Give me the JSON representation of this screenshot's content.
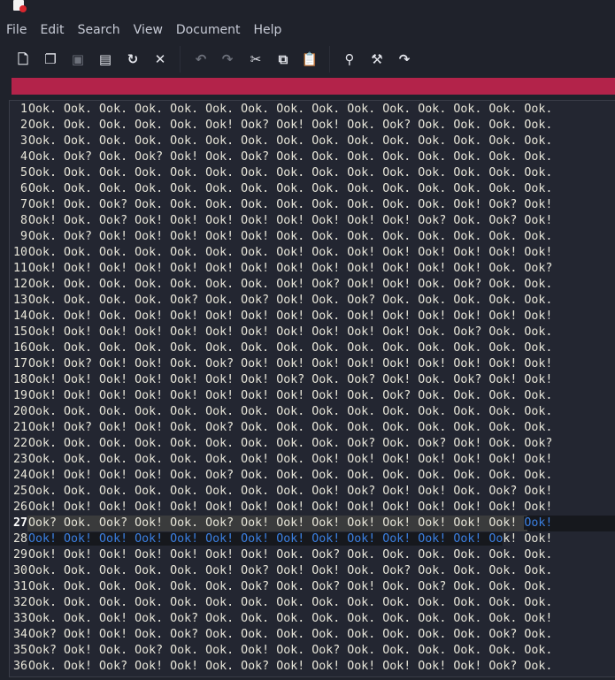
{
  "menu": [
    "File",
    "Edit",
    "Search",
    "View",
    "Document",
    "Help"
  ],
  "toolbar": [
    {
      "name": "new-document-icon",
      "glyph": "🗋"
    },
    {
      "name": "new-window-icon",
      "glyph": "❐"
    },
    {
      "name": "save-icon",
      "glyph": "▣"
    },
    {
      "name": "save-as-icon",
      "glyph": "▤"
    },
    {
      "name": "reload-icon",
      "glyph": "↻"
    },
    {
      "name": "close-icon",
      "glyph": "✕"
    },
    {
      "name": "undo-icon",
      "glyph": "↶"
    },
    {
      "name": "redo-icon",
      "glyph": "↷"
    },
    {
      "name": "cut-icon",
      "glyph": "✂"
    },
    {
      "name": "copy-icon",
      "glyph": "⧉"
    },
    {
      "name": "paste-icon",
      "glyph": "📋"
    },
    {
      "name": "find-icon",
      "glyph": "⚲"
    },
    {
      "name": "find-replace-icon",
      "glyph": "⚒"
    },
    {
      "name": "go-to-line-icon",
      "glyph": "↷"
    }
  ],
  "colors": {
    "infobar": "#b3234a",
    "selection_text": "#3b7fe0"
  },
  "lines": [
    "Ook. Ook. Ook. Ook. Ook. Ook. Ook. Ook. Ook. Ook. Ook. Ook. Ook. Ook. Ook.",
    "Ook. Ook. Ook. Ook. Ook. Ook! Ook? Ook! Ook! Ook. Ook? Ook. Ook. Ook. Ook.",
    "Ook. Ook. Ook. Ook. Ook. Ook. Ook. Ook. Ook. Ook. Ook. Ook. Ook. Ook. Ook.",
    "Ook. Ook? Ook. Ook? Ook! Ook. Ook? Ook. Ook. Ook. Ook. Ook. Ook. Ook. Ook.",
    "Ook. Ook. Ook. Ook. Ook. Ook. Ook. Ook. Ook. Ook. Ook. Ook. Ook. Ook. Ook.",
    "Ook. Ook. Ook. Ook. Ook. Ook. Ook. Ook. Ook. Ook. Ook. Ook. Ook. Ook. Ook.",
    "Ook! Ook. Ook? Ook. Ook. Ook. Ook. Ook. Ook. Ook. Ook. Ook. Ook! Ook? Ook!",
    "Ook! Ook. Ook? Ook! Ook! Ook! Ook! Ook! Ook! Ook! Ook! Ook? Ook. Ook? Ook!",
    "Ook. Ook? Ook! Ook! Ook! Ook! Ook! Ook. Ook. Ook. Ook. Ook. Ook. Ook. Ook.",
    "Ook. Ook. Ook. Ook. Ook. Ook. Ook. Ook! Ook. Ook! Ook! Ook! Ook! Ook! Ook!",
    "Ook! Ook! Ook! Ook! Ook! Ook! Ook! Ook! Ook! Ook! Ook! Ook! Ook! Ook. Ook?",
    "Ook. Ook. Ook. Ook. Ook. Ook. Ook. Ook! Ook? Ook! Ook! Ook. Ook? Ook. Ook.",
    "Ook. Ook. Ook. Ook. Ook? Ook. Ook? Ook! Ook. Ook? Ook. Ook. Ook. Ook. Ook.",
    "Ook. Ook! Ook. Ook! Ook! Ook! Ook! Ook! Ook. Ook! Ook! Ook! Ook! Ook! Ook!",
    "Ook! Ook! Ook! Ook! Ook! Ook! Ook! Ook! Ook! Ook! Ook! Ook. Ook? Ook. Ook.",
    "Ook. Ook. Ook. Ook. Ook. Ook. Ook. Ook. Ook. Ook. Ook. Ook. Ook. Ook. Ook.",
    "Ook! Ook? Ook! Ook! Ook. Ook? Ook! Ook! Ook! Ook! Ook! Ook! Ook! Ook! Ook!",
    "Ook! Ook! Ook! Ook! Ook! Ook! Ook! Ook? Ook. Ook? Ook! Ook. Ook? Ook! Ook!",
    "Ook! Ook! Ook! Ook! Ook! Ook! Ook! Ook! Ook! Ook. Ook? Ook. Ook. Ook. Ook.",
    "Ook. Ook. Ook. Ook. Ook. Ook. Ook. Ook. Ook. Ook. Ook. Ook. Ook. Ook. Ook.",
    "Ook! Ook? Ook! Ook! Ook. Ook? Ook. Ook. Ook. Ook. Ook. Ook. Ook. Ook. Ook.",
    "Ook. Ook. Ook. Ook. Ook. Ook. Ook. Ook. Ook. Ook? Ook. Ook? Ook! Ook. Ook?",
    "Ook. Ook. Ook. Ook. Ook. Ook. Ook! Ook. Ook! Ook! Ook! Ook! Ook! Ook! Ook!",
    "Ook! Ook! Ook! Ook! Ook. Ook? Ook. Ook. Ook. Ook. Ook. Ook. Ook. Ook. Ook.",
    "Ook. Ook. Ook. Ook. Ook. Ook. Ook. Ook. Ook! Ook? Ook! Ook! Ook. Ook? Ook!",
    "Ook! Ook! Ook! Ook! Ook! Ook! Ook! Ook! Ook! Ook! Ook! Ook! Ook! Ook! Ook!",
    {
      "pre": "Ook? Ook. Ook? Ook! Ook. Ook? Ook! Ook! Ook! Ook! Ook! Ook! Ook! Ook! ",
      "sel": "Ook!",
      "post": ""
    },
    {
      "pre": "",
      "sel": "Ook! Ook! Ook! Ook! Ook! Ook! Ook! Ook! Ook! Ook! Ook! Ook! Ook! Oo",
      "post": "k! Ook!"
    },
    "Ook! Ook! Ook! Ook! Ook! Ook! Ook! Ook. Ook? Ook. Ook. Ook. Ook. Ook. Ook.",
    "Ook. Ook. Ook. Ook. Ook. Ook! Ook? Ook! Ook! Ook. Ook? Ook. Ook. Ook. Ook.",
    "Ook. Ook. Ook. Ook. Ook. Ook. Ook? Ook. Ook? Ook! Ook. Ook? Ook. Ook. Ook.",
    "Ook. Ook. Ook. Ook. Ook. Ook. Ook. Ook. Ook. Ook. Ook. Ook. Ook. Ook. Ook.",
    "Ook. Ook. Ook! Ook. Ook? Ook. Ook. Ook. Ook. Ook. Ook. Ook. Ook. Ook. Ook!",
    "Ook? Ook! Ook! Ook. Ook? Ook. Ook. Ook. Ook. Ook. Ook. Ook. Ook. Ook? Ook.",
    "Ook? Ook! Ook. Ook? Ook. Ook. Ook! Ook. Ook? Ook. Ook. Ook. Ook. Ook. Ook.",
    "Ook. Ook! Ook? Ook! Ook! Ook. Ook? Ook! Ook! Ook! Ook! Ook! Ook! Ook? Ook."
  ],
  "current_line": 27
}
